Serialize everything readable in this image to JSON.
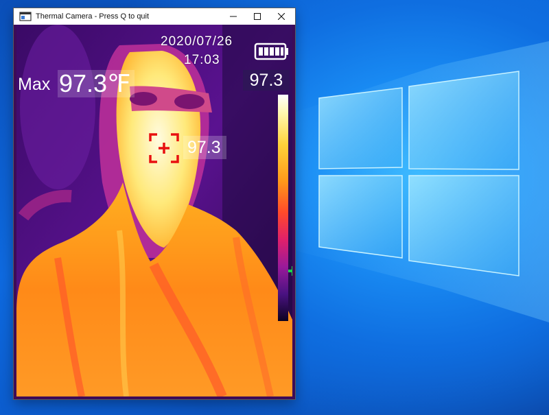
{
  "window": {
    "title": "Thermal Camera - Press Q to quit",
    "icon": "app-window-icon",
    "controls": [
      "minimize-icon",
      "maximize-icon",
      "close-icon"
    ]
  },
  "overlay": {
    "date": "2020/07/26",
    "time": "17:03",
    "battery": {
      "icon": "battery-icon",
      "level_bars": 5,
      "level_fraction": 1.0
    },
    "max_label": "Max",
    "max_value": "97.3℉",
    "scale_max_value": "97.3",
    "center_value": "97.3",
    "center_marker_icon": "crosshair-icon",
    "scale_marker_icon": "plus-icon"
  },
  "colors": {
    "crosshair": "#e81010",
    "scale_marker": "#19d64a",
    "window_title_bg": "#ffffff"
  },
  "desktop": {
    "background": "windows-logo-wallpaper"
  }
}
